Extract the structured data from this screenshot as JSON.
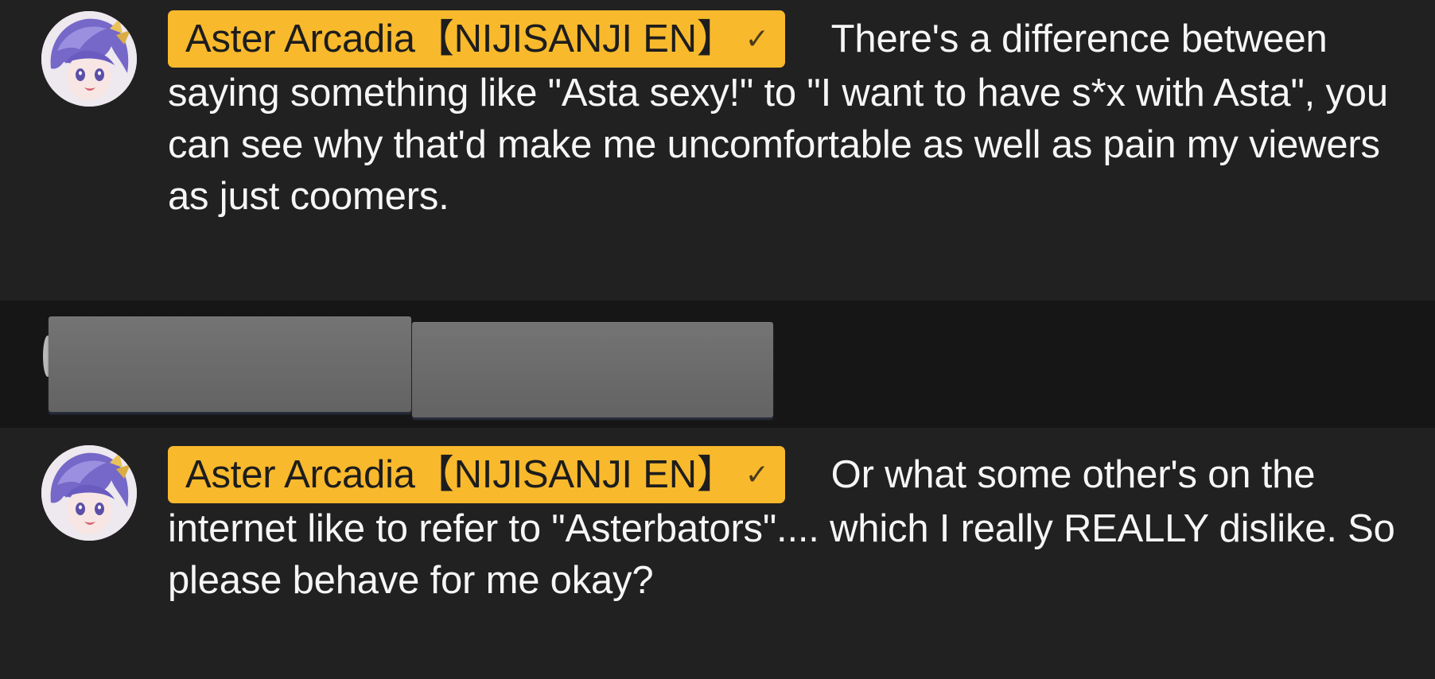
{
  "messages": [
    {
      "author": "Aster Arcadia【NIJISANJI EN】",
      "verified_icon": "✓",
      "text": "There's a difference between saying something like \"Asta sexy!\" to \"I want to have s*x with Asta\", you can see why that'd make me uncomfortable as well as pain my viewers as just coomers."
    },
    {
      "author": "Aster Arcadia【NIJISANJI EN】",
      "verified_icon": "✓",
      "text": "Or what some other's on the internet like to refer to \"Asterbators\".... which I really REALLY dislike. So please behave for me okay?"
    }
  ],
  "colors": {
    "background": "#212121",
    "redacted_row_background": "#161616",
    "author_chip": "#f8b92c",
    "author_text": "#1d1d1d",
    "message_text": "#f6f6f6",
    "redaction_box": "#6b6b6b"
  },
  "icons": {
    "avatar": "avatar-image",
    "verified": "verified-check-icon"
  }
}
